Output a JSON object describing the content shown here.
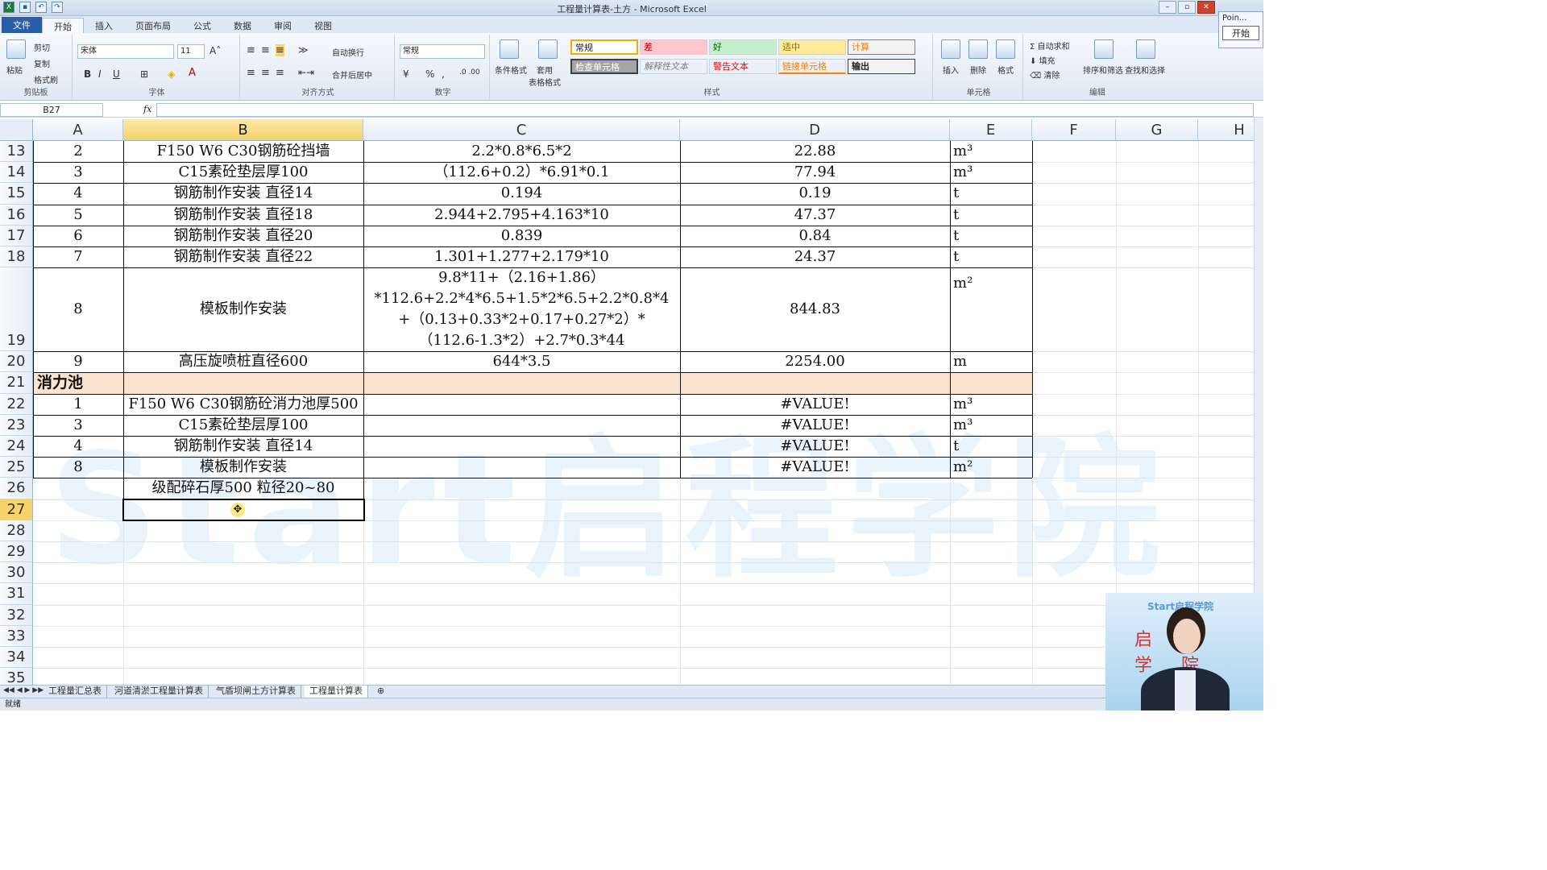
{
  "window": {
    "title": "工程量计算表-土方 - Microsoft Excel"
  },
  "tabs": [
    "文件",
    "开始",
    "插入",
    "页面布局",
    "公式",
    "数据",
    "审阅",
    "视图"
  ],
  "ribbon": {
    "clipboard": {
      "paste": "粘贴",
      "cut": "剪切",
      "copy": "复制",
      "format_painter": "格式刷",
      "label": "剪贴板"
    },
    "font": {
      "name": "宋体",
      "size": "11",
      "label": "字体"
    },
    "alignment": {
      "wrap": "自动换行",
      "merge": "合并后居中",
      "label": "对齐方式"
    },
    "number": {
      "format": "常规",
      "label": "数字"
    },
    "styles": {
      "conditional": "条件格式",
      "table": "套用\n表格格式",
      "cells": [
        {
          "text": "常规",
          "bg": "#ffffff"
        },
        {
          "text": "差",
          "bg": "#ffc7ce"
        },
        {
          "text": "好",
          "bg": "#c6efce"
        },
        {
          "text": "适中",
          "bg": "#ffeb9c"
        },
        {
          "text": "计算",
          "bg": "#f2f2f2"
        },
        {
          "text": "检查单元格",
          "bg": "#a5a5a5"
        },
        {
          "text": "解释性文本",
          "bg": "#ffffff"
        },
        {
          "text": "警告文本",
          "bg": "#ffffff"
        },
        {
          "text": "链接单元格",
          "bg": "#ffffff"
        },
        {
          "text": "输出",
          "bg": "#f2f2f2"
        }
      ],
      "label": "样式"
    },
    "cells": {
      "insert": "插入",
      "delete": "删除",
      "format": "格式",
      "label": "单元格"
    },
    "editing": {
      "autosum": "自动求和",
      "fill": "填充",
      "clear": "清除",
      "sort": "排序和筛选",
      "find": "查找和选择",
      "label": "编辑"
    }
  },
  "popup": {
    "title": "Poin...",
    "button": "开始"
  },
  "formula_bar": {
    "name_box": "B27",
    "fx": "fx",
    "value": ""
  },
  "columns": [
    "A",
    "B",
    "C",
    "D",
    "E",
    "F",
    "G",
    "H"
  ],
  "selected_column": "B",
  "rows": [
    {
      "num": "13",
      "a": "2",
      "b": "F150 W6 C30钢筋砼挡墙",
      "c": "2.2*0.8*6.5*2",
      "d": "22.88",
      "e": "m³"
    },
    {
      "num": "14",
      "a": "3",
      "b": "C15素砼垫层厚100",
      "c": "（112.6+0.2）*6.91*0.1",
      "d": "77.94",
      "e": "m³"
    },
    {
      "num": "15",
      "a": "4",
      "b": "钢筋制作安装 直径14",
      "c": "0.194",
      "d": "0.19",
      "e": "t"
    },
    {
      "num": "16",
      "a": "5",
      "b": "钢筋制作安装 直径18",
      "c": "2.944+2.795+4.163*10",
      "d": "47.37",
      "e": "t"
    },
    {
      "num": "17",
      "a": "6",
      "b": "钢筋制作安装 直径20",
      "c": "0.839",
      "d": "0.84",
      "e": "t"
    },
    {
      "num": "18",
      "a": "7",
      "b": "钢筋制作安装 直径22",
      "c": "1.301+1.277+2.179*10",
      "d": "24.37",
      "e": "t"
    },
    {
      "num": "19",
      "a": "8",
      "b": "模板制作安装",
      "c1": "9.8*11+（2.16+1.86）",
      "c2": "*112.6+2.2*4*6.5+1.5*2*6.5+2.2*0.8*4",
      "c3": "+（0.13+0.33*2+0.17+0.27*2）*",
      "c4": "（112.6-1.3*2）+2.7*0.3*44",
      "d": "844.83",
      "e": "m²"
    },
    {
      "num": "20",
      "a": "9",
      "b": "高压旋喷桩直径600",
      "c": "644*3.5",
      "d": "2254.00",
      "e": "m"
    },
    {
      "num": "21",
      "a": "消力池"
    },
    {
      "num": "22",
      "a": "1",
      "b": "F150 W6 C30钢筋砼消力池厚500",
      "c": "",
      "d": "#VALUE!",
      "e": "m³"
    },
    {
      "num": "23",
      "a": "3",
      "b": "C15素砼垫层厚100",
      "c": "",
      "d": "#VALUE!",
      "e": "m³"
    },
    {
      "num": "24",
      "a": "4",
      "b": "钢筋制作安装 直径14",
      "c": "",
      "d": "#VALUE!",
      "e": "t"
    },
    {
      "num": "25",
      "a": "8",
      "b": "模板制作安装",
      "c": "",
      "d": "#VALUE!",
      "e": "m²"
    },
    {
      "num": "26",
      "a": "",
      "b": "级配碎石厚500 粒径20~80",
      "c": "",
      "d": "",
      "e": ""
    },
    {
      "num": "27"
    },
    {
      "num": "28"
    },
    {
      "num": "29"
    },
    {
      "num": "30"
    },
    {
      "num": "31"
    },
    {
      "num": "32"
    },
    {
      "num": "33"
    },
    {
      "num": "34"
    },
    {
      "num": "35"
    }
  ],
  "watermark": "Start启程学院",
  "sheets": [
    "工程量汇总表",
    "河道清淤工程量计算表",
    "气盾坝闸土方计算表",
    "工程量计算表"
  ],
  "active_sheet": "工程量计算表",
  "status": "就绪",
  "webcam": {
    "logo": "Start启程学院",
    "caption": "启程学院"
  }
}
